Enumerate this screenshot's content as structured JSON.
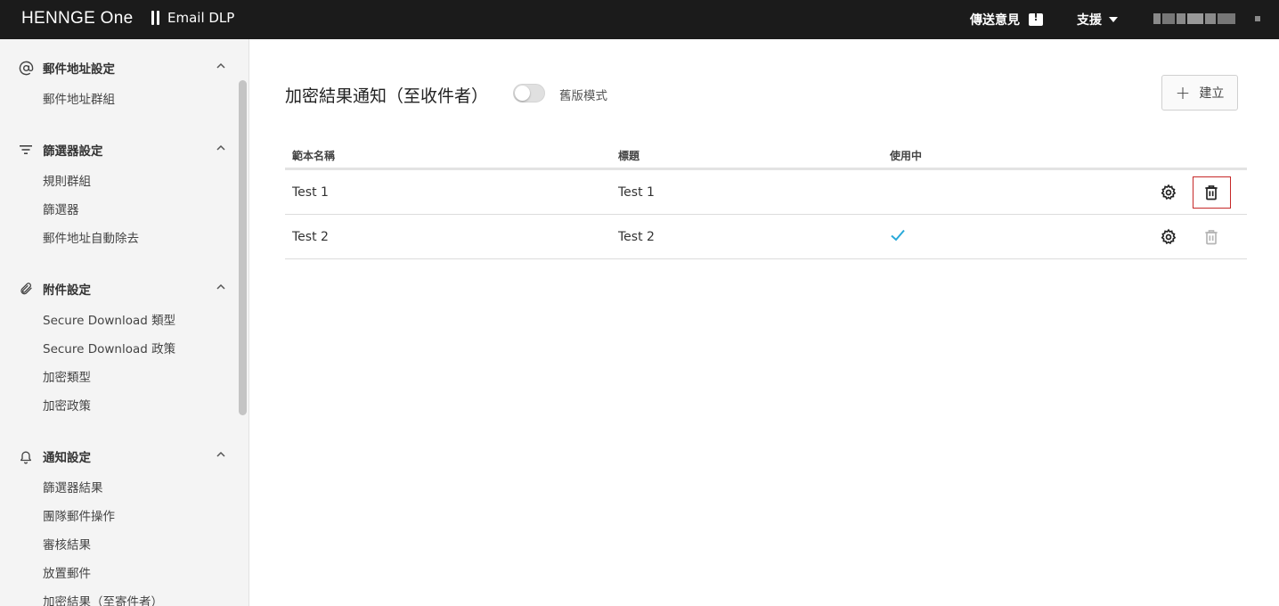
{
  "topbar": {
    "logo": "HENNGE One",
    "product": "Email DLP",
    "feedback": "傳送意見",
    "support": "支援"
  },
  "sidebar": {
    "sections": [
      {
        "title": "郵件地址設定",
        "icon": "at-icon",
        "items": [
          "郵件地址群組"
        ]
      },
      {
        "title": "篩選器設定",
        "icon": "filter-icon",
        "items": [
          "規則群組",
          "篩選器",
          "郵件地址自動除去"
        ]
      },
      {
        "title": "附件設定",
        "icon": "paperclip-icon",
        "items": [
          "Secure Download 類型",
          "Secure Download 政策",
          "加密類型",
          "加密政策"
        ]
      },
      {
        "title": "通知設定",
        "icon": "bell-icon",
        "items": [
          "篩選器結果",
          "團隊郵件操作",
          "審核結果",
          "放置郵件",
          "加密結果（至寄件者）"
        ]
      }
    ]
  },
  "main": {
    "title": "加密結果通知（至收件者）",
    "toggle_label": "舊版模式",
    "legacy_mode_on": false,
    "create_label": "建立",
    "columns": [
      "範本名稱",
      "標題",
      "使用中"
    ],
    "rows": [
      {
        "name": "Test 1",
        "subject": "Test 1",
        "in_use": false
      },
      {
        "name": "Test 2",
        "subject": "Test 2",
        "in_use": true
      }
    ]
  },
  "colors": {
    "topbar": "#1b1b1b",
    "check": "#29a9d9",
    "highlight": "#c62828"
  }
}
